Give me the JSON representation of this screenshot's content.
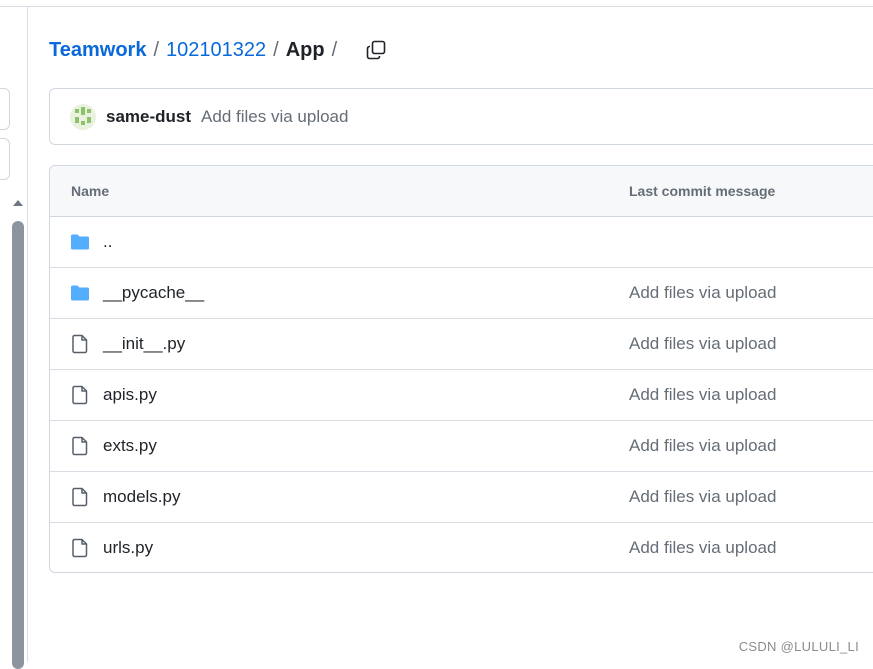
{
  "breadcrumb": {
    "repo_owner": "Teamwork",
    "repo": "102101322",
    "current": "App",
    "separator": "/"
  },
  "latest_commit": {
    "author": "same-dust",
    "message": "Add files via upload"
  },
  "table": {
    "headers": {
      "name": "Name",
      "last_commit": "Last commit message"
    },
    "rows": [
      {
        "name": "..",
        "type": "folder",
        "message": ""
      },
      {
        "name": "__pycache__",
        "type": "folder",
        "message": "Add files via upload"
      },
      {
        "name": "__init__.py",
        "type": "file",
        "message": "Add files via upload"
      },
      {
        "name": "apis.py",
        "type": "file",
        "message": "Add files via upload"
      },
      {
        "name": "exts.py",
        "type": "file",
        "message": "Add files via upload"
      },
      {
        "name": "models.py",
        "type": "file",
        "message": "Add files via upload"
      },
      {
        "name": "urls.py",
        "type": "file",
        "message": "Add files via upload"
      }
    ]
  },
  "watermark": "CSDN @LULULI_LI",
  "icons": {
    "folder": "folder-icon",
    "file": "file-icon",
    "copy": "copy-icon"
  },
  "colors": {
    "link": "#0969da",
    "folder": "#54aeff",
    "muted": "#656d76"
  }
}
